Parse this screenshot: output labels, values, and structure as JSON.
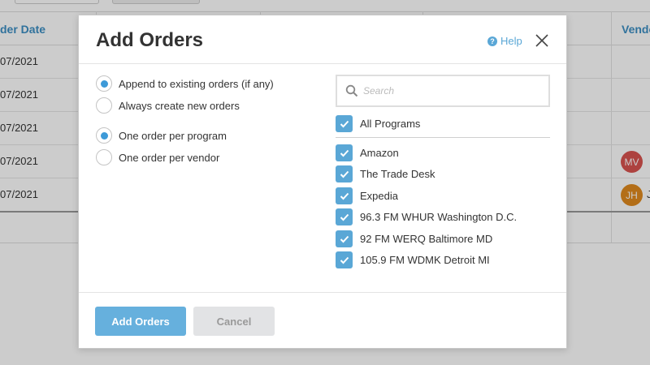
{
  "background": {
    "columns": {
      "date": "der Date",
      "vendor": "Vendo"
    },
    "rows": [
      {
        "date": "07/2021",
        "avatar": null
      },
      {
        "date": "07/2021",
        "avatar": null
      },
      {
        "date": "07/2021",
        "avatar": null
      },
      {
        "date": "07/2021",
        "avatar": {
          "initials": "MV",
          "color": "#d9534f"
        }
      },
      {
        "date": "07/2021",
        "avatar": {
          "initials": "JH",
          "color": "#e08a1e"
        },
        "trail": "J"
      }
    ]
  },
  "modal": {
    "title": "Add Orders",
    "help_label": "Help",
    "append_group": [
      {
        "label": "Append to existing orders (if any)",
        "checked": true
      },
      {
        "label": "Always create new orders",
        "checked": false
      }
    ],
    "order_group": [
      {
        "label": "One order per program",
        "checked": true
      },
      {
        "label": "One order per vendor",
        "checked": false
      }
    ],
    "search": {
      "placeholder": "Search",
      "value": ""
    },
    "all_programs": {
      "label": "All Programs",
      "checked": true
    },
    "programs": [
      {
        "label": "Amazon",
        "checked": true
      },
      {
        "label": "The Trade Desk",
        "checked": true
      },
      {
        "label": "Expedia",
        "checked": true
      },
      {
        "label": "96.3 FM WHUR Washington D.C.",
        "checked": true
      },
      {
        "label": "92 FM WERQ Baltimore MD",
        "checked": true
      },
      {
        "label": "105.9 FM WDMK Detroit MI",
        "checked": true
      }
    ],
    "add_button": "Add Orders",
    "cancel_button": "Cancel"
  },
  "colors": {
    "accent": "#5aa7d6",
    "primary_button": "#66b0dd",
    "radio_dot": "#3d9ad8"
  }
}
